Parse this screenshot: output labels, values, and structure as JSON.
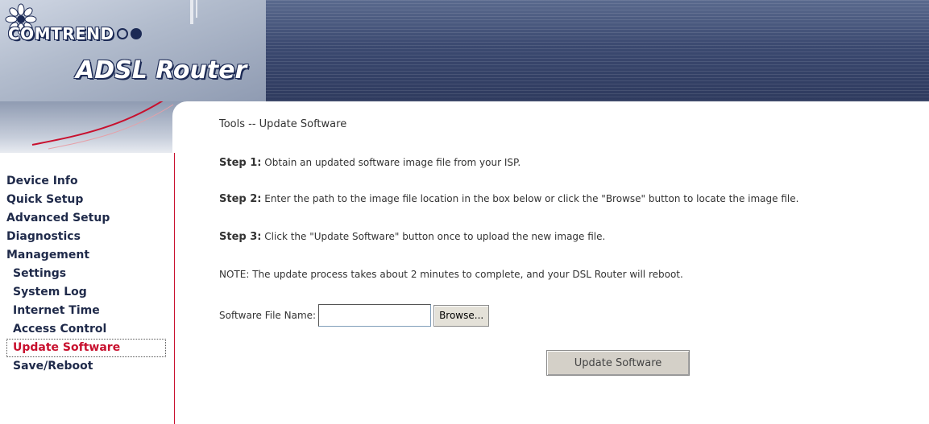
{
  "header": {
    "brand": "COMTREND",
    "product": "ADSL Router"
  },
  "sidebar": {
    "items": [
      {
        "label": "Device Info"
      },
      {
        "label": "Quick Setup"
      },
      {
        "label": "Advanced Setup"
      },
      {
        "label": "Diagnostics"
      },
      {
        "label": "Management"
      },
      {
        "label": "Settings"
      },
      {
        "label": "System Log"
      },
      {
        "label": "Internet Time"
      },
      {
        "label": "Access Control"
      },
      {
        "label": "Update Software"
      },
      {
        "label": "Save/Reboot"
      }
    ],
    "active_item": "Update Software"
  },
  "main": {
    "title": "Tools -- Update Software",
    "step1_label": "Step 1:",
    "step1_text": " Obtain an updated software image file from your ISP.",
    "step2_label": "Step 2:",
    "step2_text": " Enter the path to the image file location in the box below or click the \"Browse\" button to locate the image file.",
    "step3_label": "Step 3:",
    "step3_text": " Click the \"Update Software\" button once to upload the new image file.",
    "note": "NOTE: The update process takes about 2 minutes to complete, and your DSL Router will reboot.",
    "file_label": "Software File Name:",
    "file_value": "",
    "browse_label": "Browse...",
    "update_label": "Update Software"
  },
  "colors": {
    "active_menu": "#c8102e",
    "menu_text": "#1f2a4a",
    "banner_dark": "#2e3a5e"
  }
}
